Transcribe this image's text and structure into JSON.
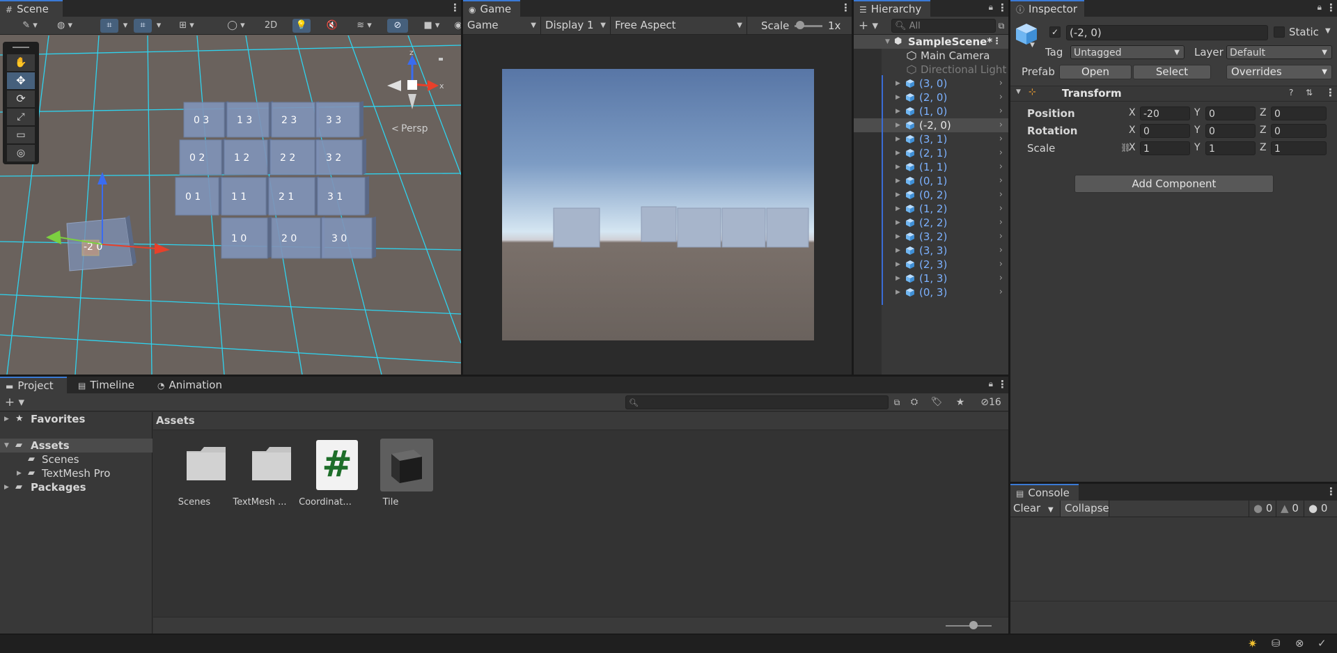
{
  "scene": {
    "tab": "Scene",
    "mode_2d": "2D",
    "persp": "Persp",
    "gizmo_z": "z",
    "gizmo_x": "x",
    "tile_labels": [
      "0 3",
      "1 3",
      "2 3",
      "3 3",
      "0 2",
      "1 2",
      "2 2",
      "3 2",
      "0 1",
      "1 1",
      "2 1",
      "3 1",
      "1 0",
      "2 0",
      "3 0"
    ],
    "selected_label": "-2 0"
  },
  "game": {
    "tab": "Game",
    "mode": "Game",
    "display": "Display 1",
    "aspect": "Free Aspect",
    "scale_label": "Scale",
    "scale_value": "1x"
  },
  "hierarchy": {
    "tab": "Hierarchy",
    "search_placeholder": "All",
    "scene_name": "SampleScene*",
    "items": [
      {
        "label": "Main Camera",
        "kind": "camera"
      },
      {
        "label": "Directional Light",
        "kind": "light"
      },
      {
        "label": "(3, 0)",
        "kind": "prefab"
      },
      {
        "label": "(2, 0)",
        "kind": "prefab"
      },
      {
        "label": "(1, 0)",
        "kind": "prefab"
      },
      {
        "label": "(-2, 0)",
        "kind": "prefab-selected"
      },
      {
        "label": "(3, 1)",
        "kind": "prefab"
      },
      {
        "label": "(2, 1)",
        "kind": "prefab"
      },
      {
        "label": "(1, 1)",
        "kind": "prefab"
      },
      {
        "label": "(0, 1)",
        "kind": "prefab"
      },
      {
        "label": "(0, 2)",
        "kind": "prefab"
      },
      {
        "label": "(1, 2)",
        "kind": "prefab"
      },
      {
        "label": "(2, 2)",
        "kind": "prefab"
      },
      {
        "label": "(3, 2)",
        "kind": "prefab"
      },
      {
        "label": "(3, 3)",
        "kind": "prefab"
      },
      {
        "label": "(2, 3)",
        "kind": "prefab"
      },
      {
        "label": "(1, 3)",
        "kind": "prefab"
      },
      {
        "label": "(0, 3)",
        "kind": "prefab"
      }
    ]
  },
  "inspector": {
    "tab": "Inspector",
    "object_name": "(-2, 0)",
    "static_label": "Static",
    "tag_label": "Tag",
    "tag_value": "Untagged",
    "layer_label": "Layer",
    "layer_value": "Default",
    "prefab_label": "Prefab",
    "open_btn": "Open",
    "select_btn": "Select",
    "overrides": "Overrides",
    "component": "Transform",
    "position_label": "Position",
    "rotation_label": "Rotation",
    "scale_label": "Scale",
    "axis_x": "X",
    "axis_y": "Y",
    "axis_z": "Z",
    "position": {
      "x": "-20",
      "y": "0",
      "z": "0"
    },
    "rotation": {
      "x": "0",
      "y": "0",
      "z": "0"
    },
    "scale": {
      "x": "1",
      "y": "1",
      "z": "1"
    },
    "add_component": "Add Component"
  },
  "project": {
    "tabs": [
      "Project",
      "Timeline",
      "Animation"
    ],
    "hidden_count": "16",
    "favorites": "Favorites",
    "assets": "Assets",
    "scenes": "Scenes",
    "textmesh": "TextMesh Pro",
    "packages": "Packages",
    "breadcrumb": "Assets",
    "files": [
      {
        "name": "Scenes",
        "icon": "folder-icon"
      },
      {
        "name": "TextMesh ...",
        "icon": "folder-icon"
      },
      {
        "name": "Coordinat...",
        "icon": "script-icon"
      },
      {
        "name": "Tile",
        "icon": "cube-icon"
      }
    ]
  },
  "console": {
    "tab": "Console",
    "clear": "Clear",
    "collapse": "Collapse",
    "info_count": "0",
    "warn_count": "0",
    "error_count": "0"
  },
  "colors": {
    "accent": "#3a7ad6",
    "prefab_blue": "#7cb1ff",
    "panel": "#383838",
    "grid_line": "#28e0ff"
  }
}
